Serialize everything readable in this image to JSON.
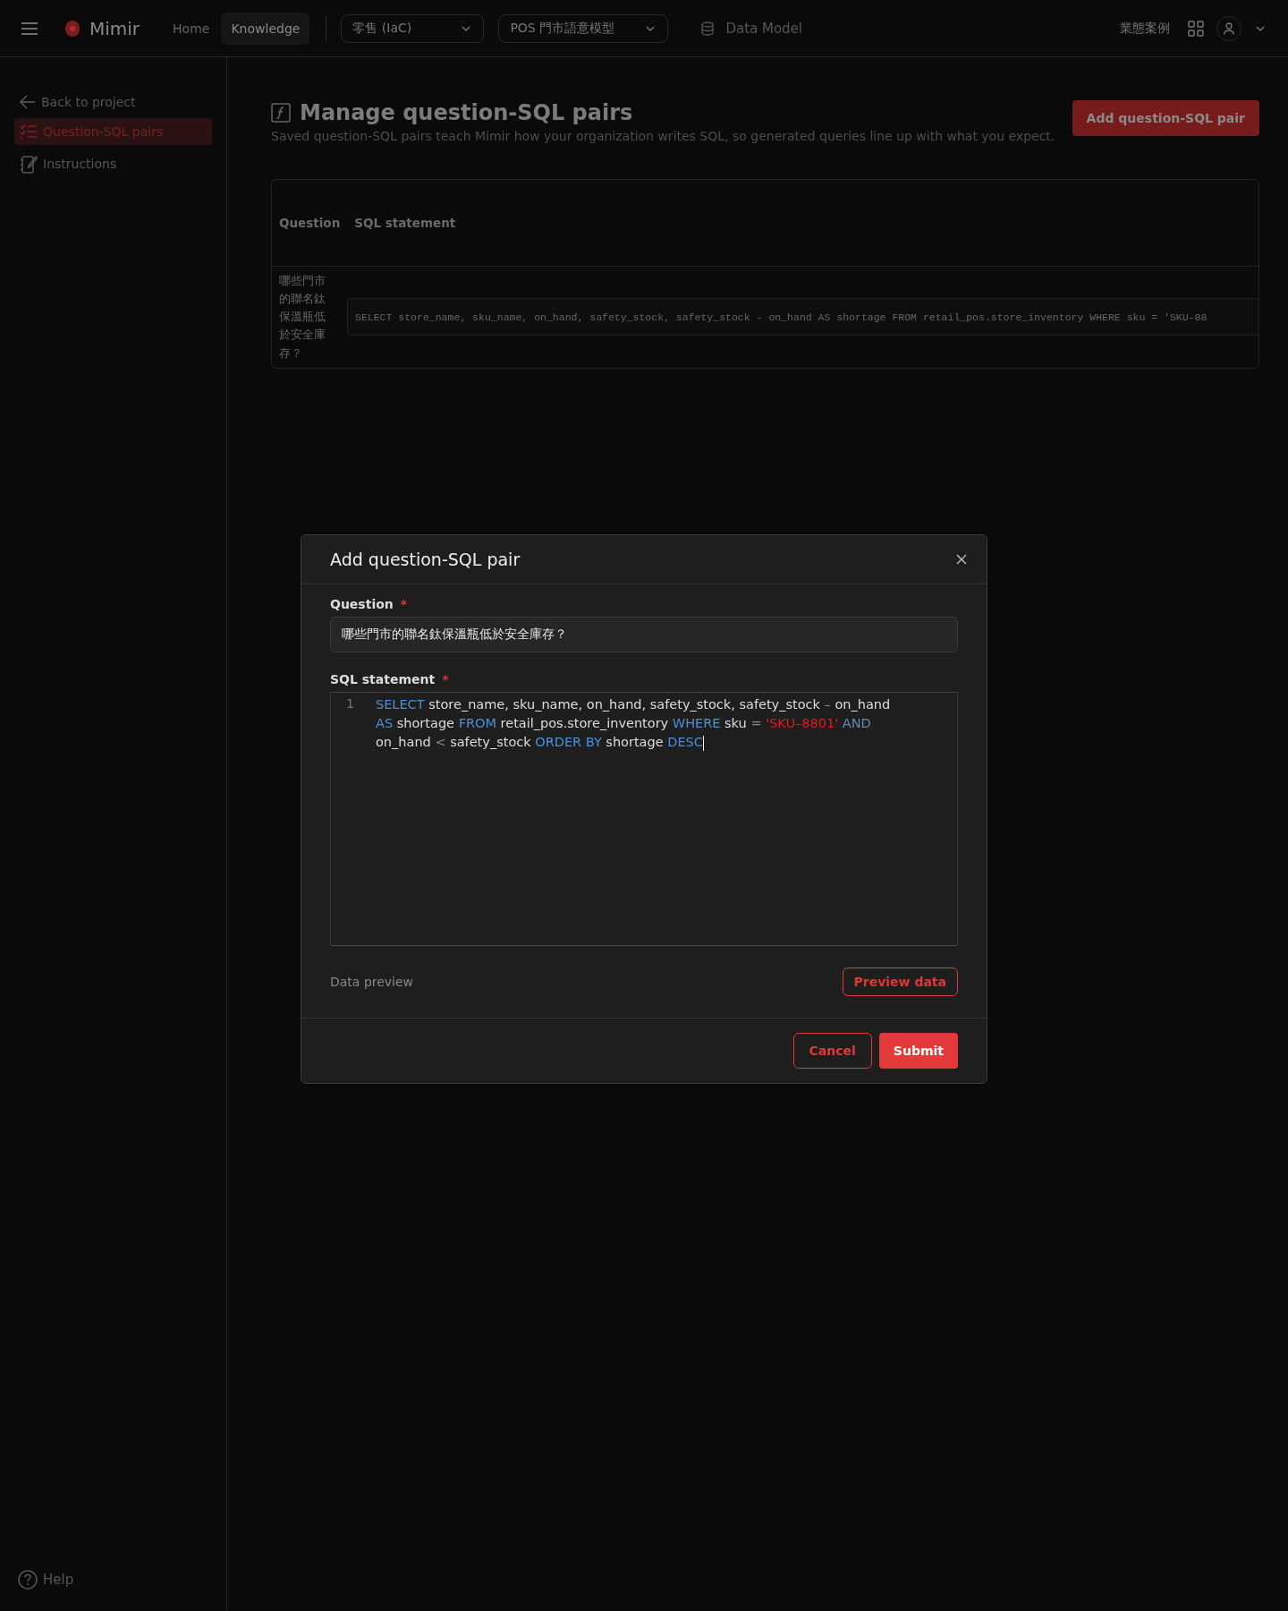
{
  "topbar": {
    "app_name": "Mimir",
    "nav": [
      {
        "label": "Home",
        "selected": false
      },
      {
        "label": "Knowledge",
        "selected": true
      }
    ],
    "dropdowns": [
      {
        "value": "零售 (IaC)"
      },
      {
        "value": "POS 門市語意模型"
      }
    ],
    "data_model": "Data Model",
    "cases": "業態案例"
  },
  "sidebar": {
    "back": "Back to project",
    "items": [
      {
        "label": "Question-SQL pairs",
        "kind": "checklist",
        "selected": true
      },
      {
        "label": "Instructions",
        "kind": "notebook",
        "selected": false
      }
    ],
    "help": "Help"
  },
  "page": {
    "title": "Manage question-SQL pairs",
    "subtitle": "Saved question-SQL pairs teach Mimir how your organization writes SQL, so generated queries line up with what you expect.",
    "add_button": "Add question-SQL pair",
    "table": {
      "columns": [
        "Question",
        "SQL statement"
      ],
      "rows": [
        {
          "question": "哪些門市的聯名鈦保溫瓶低於安全庫存？",
          "sql": "SELECT store_name, sku_name, on_hand, safety_stock, safety_stock - on_hand AS shortage FROM retail_pos.store_inventory WHERE sku = 'SKU-88"
        }
      ]
    }
  },
  "modal": {
    "title": "Add question-SQL pair",
    "question_label": "Question",
    "question_value": "哪些門市的聯名鈦保溫瓶低於安全庫存？",
    "sql_label": "SQL statement",
    "required_mark": "*",
    "editor": {
      "line_number": "1",
      "tokens": [
        {
          "text": "SELECT",
          "kind": "keyword"
        },
        {
          "text": "store_name,",
          "kind": "plain"
        },
        {
          "text": "sku_name,",
          "kind": "plain"
        },
        {
          "text": "on_hand,",
          "kind": "plain"
        },
        {
          "text": "safety_stock,",
          "kind": "plain"
        },
        {
          "text": "safety_stock",
          "kind": "plain"
        },
        {
          "text": "–",
          "kind": "operator"
        },
        {
          "text": "on_hand",
          "kind": "plain"
        },
        {
          "text": "AS",
          "kind": "keyword"
        },
        {
          "text": "shortage",
          "kind": "plain"
        },
        {
          "text": "FROM",
          "kind": "keyword"
        },
        {
          "text": "retail_pos.store_inventory",
          "kind": "plain"
        },
        {
          "text": "WHERE",
          "kind": "keyword"
        },
        {
          "text": "sku",
          "kind": "plain"
        },
        {
          "text": "=",
          "kind": "operator"
        },
        {
          "text": "'SKU–8801'",
          "kind": "string"
        },
        {
          "text": "AND",
          "kind": "logic"
        },
        {
          "text": "on_hand",
          "kind": "plain"
        },
        {
          "text": "<",
          "kind": "operator"
        },
        {
          "text": "safety_stock",
          "kind": "plain"
        },
        {
          "text": "ORDER BY",
          "kind": "keyword"
        },
        {
          "text": "shortage",
          "kind": "plain"
        },
        {
          "text": "DESC",
          "kind": "keyword"
        }
      ]
    },
    "preview_label": "Data preview",
    "preview_button": "Preview data",
    "cancel": "Cancel",
    "submit": "Submit"
  }
}
